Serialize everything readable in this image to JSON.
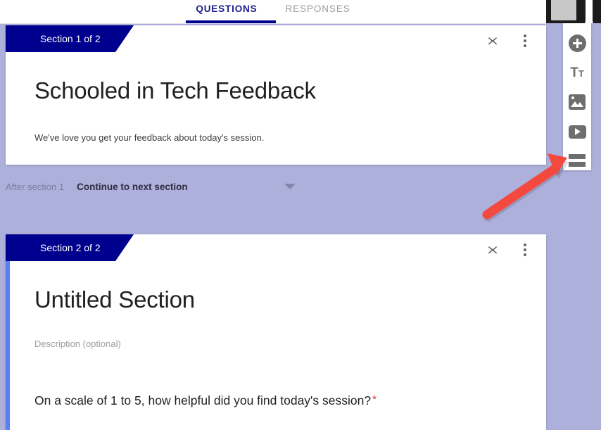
{
  "app": {
    "name": "Google Forms editor"
  },
  "tabs": [
    {
      "label": "QUESTIONS",
      "active": true
    },
    {
      "label": "RESPONSES",
      "active": false
    }
  ],
  "sections": [
    {
      "banner": "Section 1 of 2",
      "title": "Schooled in Tech Feedback",
      "description": "We've love you get your feedback about today's session.",
      "collapse_icon": "collapse-expand-icon",
      "menu_icon": "more-options-icon"
    },
    {
      "banner": "Section 2 of 2",
      "title": "Untitled Section",
      "description_placeholder": "Description (optional)",
      "collapse_icon": "collapse-expand-icon",
      "menu_icon": "more-options-icon",
      "question": {
        "text": "On a scale of 1 to 5, how helpful did you find today's session?",
        "required_marker": "*"
      }
    }
  ],
  "navigation": {
    "after_section_label": "After section 1",
    "selected_option": "Continue to next section",
    "caret_icon": "chevron-down-icon"
  },
  "toolbar": {
    "items": [
      {
        "icon": "add-question-icon",
        "name": "add-question"
      },
      {
        "icon": "add-title-and-description-icon",
        "name": "add-title",
        "glyph_big": "T",
        "glyph_small": "T"
      },
      {
        "icon": "add-image-icon",
        "name": "add-image"
      },
      {
        "icon": "add-video-icon",
        "name": "add-video"
      },
      {
        "icon": "add-section-icon",
        "name": "add-section"
      }
    ]
  },
  "annotation": {
    "arrow_color": "#f4493f",
    "points_to": "add-section-icon"
  },
  "colors": {
    "page_background": "#aeb0dc",
    "section_banner": "#00008f",
    "active_tab": "#1a1a8c",
    "inactive_tab": "#9c9c9c",
    "card_accent": "#5b7ff0",
    "required_star": "#d93025",
    "toolbar_icon": "#6e6e6e"
  }
}
